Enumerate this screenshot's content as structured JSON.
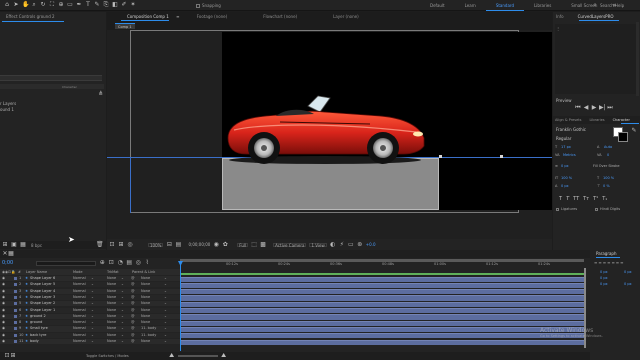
{
  "toolbar": {
    "snapping_label": "Snapping"
  },
  "workspaces": [
    "Default",
    "Learn",
    "Standard",
    "Libraries",
    "Small Screen"
  ],
  "active_workspace": "Standard",
  "search_help_placeholder": "Search Help",
  "left_panel": {
    "tab_title": "Effect Controls ground 2",
    "menu_label": "Character",
    "items": [
      "r Layers",
      "ound 1"
    ],
    "bottom_label": "8 bpc"
  },
  "composition_tab": "Composition Comp 1",
  "footage_tab": "Footage (none)",
  "flowchart_tab": "Flowchart (none)",
  "layer_tab": "Layer (none)",
  "comp_subtab": "Comp 1",
  "viewer_controls": {
    "zoom": "100%",
    "timecode": "0;00;00;00",
    "resolution": "Full",
    "camera": "Active Camera",
    "views": "1 View",
    "offset": "+0.0"
  },
  "right_panel": {
    "info_tab": "Info",
    "effects_tab": "CurvedLayersPRO",
    "preview_label": "Preview",
    "align_tab": "Align & Presets",
    "libraries_tab": "Libraries",
    "character_tab": "Character",
    "font_name": "Franklin Gothic",
    "font_style": "Regular",
    "font_size": "17 px",
    "leading": "Auto",
    "kerning": "Metrics",
    "tracking": "0",
    "stroke_width": "0 px",
    "stroke_type": "Fill Over Stroke",
    "vert_scale": "100 %",
    "horiz_scale": "100 %",
    "baseline": "0 px",
    "tsume": "0 %",
    "ligatures_label": "Ligatures",
    "hindi_digits_label": "Hindi Digits",
    "paragraph_label": "Paragraph",
    "para_values": [
      "0 px",
      "0 px",
      "0 px",
      "0 px",
      "0 px"
    ]
  },
  "timeline": {
    "timecode": "0;00",
    "columns": {
      "layer_name": "Layer Name",
      "mode": "Mode",
      "trkmat": "TrkMat",
      "parent": "Parent & Link"
    },
    "layers": [
      {
        "num": "1",
        "name": "Shape Layer 6",
        "mode": "Normal",
        "trkmat": "None",
        "parent": "None"
      },
      {
        "num": "2",
        "name": "Shape Layer 5",
        "mode": "Normal",
        "trkmat": "None",
        "parent": "None"
      },
      {
        "num": "3",
        "name": "Shape Layer 4",
        "mode": "Normal",
        "trkmat": "None",
        "parent": "None"
      },
      {
        "num": "4",
        "name": "Shape Layer 3",
        "mode": "Normal",
        "trkmat": "None",
        "parent": "None"
      },
      {
        "num": "5",
        "name": "Shape Layer 2",
        "mode": "Normal",
        "trkmat": "None",
        "parent": "None"
      },
      {
        "num": "6",
        "name": "Shape Layer 1",
        "mode": "Normal",
        "trkmat": "None",
        "parent": "None"
      },
      {
        "num": "7",
        "name": "ground 2",
        "mode": "Normal",
        "trkmat": "None",
        "parent": "None"
      },
      {
        "num": "8",
        "name": "ground",
        "mode": "Normal",
        "trkmat": "None",
        "parent": "None"
      },
      {
        "num": "9",
        "name": "Small tyre",
        "mode": "Normal",
        "trkmat": "None",
        "parent": "11. body"
      },
      {
        "num": "10",
        "name": "back tyre",
        "mode": "Normal",
        "trkmat": "None",
        "parent": "11. body"
      },
      {
        "num": "11",
        "name": "body",
        "mode": "Normal",
        "trkmat": "None",
        "parent": "None"
      }
    ],
    "ruler_marks": [
      "00:12s",
      "00:24s",
      "00:36s",
      "00:48s",
      "01:00s",
      "01:12s",
      "01:24s"
    ],
    "toggle_label": "Toggle Switches / Modes"
  },
  "watermark": {
    "line1": "Activate Windows",
    "line2": "Go to Settings to activate Windows."
  },
  "colors": {
    "accent": "#2d8ceb",
    "timeline_bar": "#5c6d9f",
    "work_area": "#5fb05a",
    "car_red": "#d9241b",
    "canvas_black": "#000000",
    "ground_grey": "#8a8a8a"
  }
}
